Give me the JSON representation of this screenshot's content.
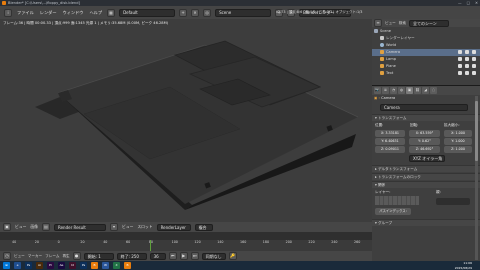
{
  "window": {
    "title": "Blender* [C:\\Users\\...\\floppy_disk.blend]"
  },
  "menubar": {
    "items": [
      "ファイル",
      "レンダー",
      "ウィンドウ",
      "ヘルプ"
    ],
    "layout": "Default",
    "scene": "Scene",
    "engine": "Blenderレンダー",
    "stats": "v2.73 | 頂点:8/6 | 面:1/1 | 三角:3/3 | オブジェクト:1/3"
  },
  "viewport": {
    "info_line1": "フレーム:36 | 時間 00:00.33 | 頂点:999 面:1345 光源 1 | メモリ:35.68M (0.00M, ピーク 46.28M)",
    "info_line2": ""
  },
  "vp_header": {
    "items": [
      "ビュー",
      "画像",
      "Render Result",
      "ビュー",
      "スロット",
      "RenderLayer",
      "複合"
    ]
  },
  "timeline": {
    "ticks": [
      "40",
      "20",
      "0",
      "20",
      "40",
      "60",
      "80",
      "100",
      "120",
      "140",
      "160",
      "180",
      "200",
      "220",
      "240",
      "260"
    ],
    "header_items": [
      "ビュー",
      "マーカー",
      "フレーム",
      "再生"
    ],
    "start_label": "開始: 1",
    "end_label": "終了: 250",
    "current": "36",
    "sync": "同期なし"
  },
  "outliner": {
    "header": [
      "ビュー",
      "検索",
      "全てのシーン"
    ],
    "rows": [
      "Scene",
      "レンダーレイヤー",
      "World",
      "Camera",
      "Lamp",
      "Plane",
      "Text"
    ]
  },
  "properties": {
    "object_name": "Camera",
    "breadcrumb": "Camera",
    "transform_header": "トランスフォーム",
    "col_location": "位置:",
    "col_rotation": "回転:",
    "col_scale": "拡大縮小:",
    "location": [
      "X: 3.33181",
      "Y: 6.40631",
      "Z: 0.09011"
    ],
    "rotation": [
      "X: 63.559°",
      "Y: 0.62°",
      "Z: 46.692°"
    ],
    "scale": [
      "X: 1.000",
      "Y: 1.000",
      "Z: 1.000"
    ],
    "rotation_mode": "XYZ オイラー角",
    "sections": [
      "デルタトランスフォーム",
      "トランスフォームのロック",
      "関係"
    ],
    "layer_label": "レイヤー:",
    "parent_label": "親:",
    "pass_index": "パスインデックス:",
    "group_header": "グループ"
  },
  "taskbar": {
    "apps": [
      "e",
      "Ps",
      "Ai",
      "Pr",
      "Ae",
      "Id",
      "Ps",
      "B",
      "W",
      "X",
      "B"
    ],
    "time": "11:06",
    "date": "2015/08/29"
  }
}
